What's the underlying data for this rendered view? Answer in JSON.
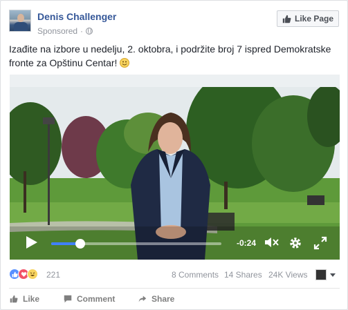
{
  "header": {
    "author": "Denis Challenger",
    "sponsored": "Sponsored",
    "like_page_label": "Like Page"
  },
  "post": {
    "text": "Izađite na izbore u nedelju, 2. oktobra, i podržite broj 7 ispred Demokratske fronte za Opštinu Centar!"
  },
  "video": {
    "time_remaining": "-0:24",
    "progress_fraction": 0.17
  },
  "stats": {
    "reaction_count": "221",
    "comments": "8 Comments",
    "shares": "14 Shares",
    "views": "24K Views"
  },
  "actions": {
    "like": "Like",
    "comment": "Comment",
    "share": "Share"
  },
  "colors": {
    "link": "#365899",
    "like_reaction": "#5890ff",
    "love_reaction": "#f25268",
    "haha_reaction": "#f7d35f",
    "progress": "#4080ff"
  }
}
